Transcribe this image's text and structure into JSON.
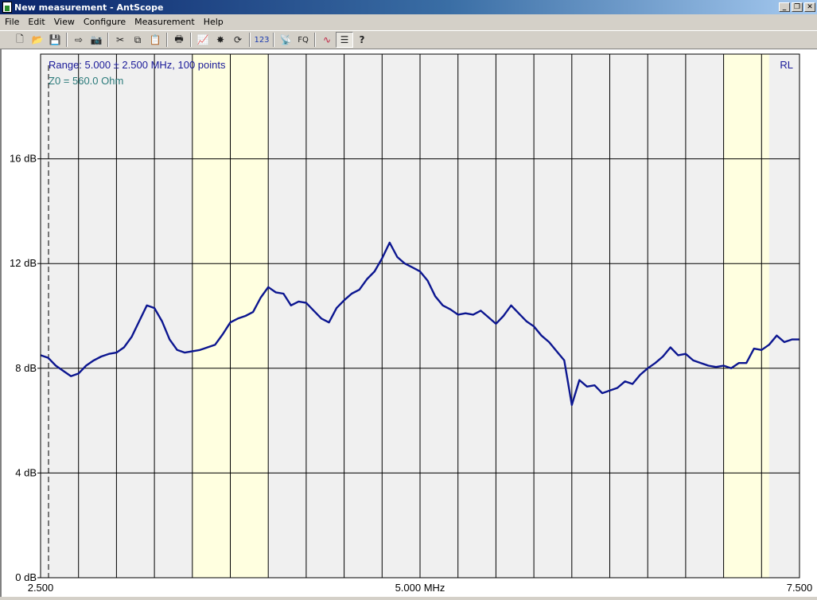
{
  "window": {
    "title": "New measurement - AntScope",
    "buttons": {
      "minimize": "_",
      "restore": "❐",
      "close": "✕"
    }
  },
  "menu": [
    "File",
    "Edit",
    "View",
    "Configure",
    "Measurement",
    "Help"
  ],
  "toolbar": {
    "buttons": [
      {
        "name": "new-icon",
        "glyph": "🗋"
      },
      {
        "name": "open-icon",
        "glyph": "📂"
      },
      {
        "name": "save-icon",
        "glyph": "💾"
      },
      {
        "name": "export-icon",
        "glyph": "⇨"
      },
      {
        "name": "camera-icon",
        "glyph": "📷"
      },
      {
        "name": "cut-icon",
        "glyph": "✂"
      },
      {
        "name": "copy-icon",
        "glyph": "⧉"
      },
      {
        "name": "paste-icon",
        "glyph": "📋"
      },
      {
        "name": "print-icon",
        "glyph": "🖶"
      },
      {
        "name": "chart-icon",
        "glyph": "📈"
      },
      {
        "name": "burst-icon",
        "glyph": "✸"
      },
      {
        "name": "refresh-icon",
        "glyph": "⟳"
      },
      {
        "name": "numbers-icon",
        "glyph": "123"
      },
      {
        "name": "antenna-icon",
        "glyph": "📡"
      },
      {
        "name": "fq-icon",
        "glyph": "FQ"
      },
      {
        "name": "wave-icon",
        "glyph": "∿"
      },
      {
        "name": "legend-icon",
        "glyph": "☰"
      },
      {
        "name": "help-icon",
        "glyph": "?"
      }
    ]
  },
  "colors": {
    "curve": "#0c1690",
    "band": "#ffffe0",
    "plot_bg": "#f0f0f0",
    "range_text": "#1a1a99",
    "z0_text": "#2a7a7a"
  },
  "chart_data": {
    "type": "line",
    "title": "",
    "info_lines": [
      "Range: 5.000 ± 2.500 MHz, 100 points",
      "Z0 = 560.0 Ohm"
    ],
    "trace_label": "RL",
    "ylim": [
      0,
      20
    ],
    "yticks": [
      0,
      4,
      8,
      12,
      16
    ],
    "ytick_labels": [
      "0 dB",
      "4 dB",
      "8 dB",
      "12 dB",
      "16 dB"
    ],
    "xlim": [
      2.5,
      7.5
    ],
    "xtick_labels": [
      "2.500",
      "5.000 MHz",
      "7.500"
    ],
    "bands_mhz": [
      [
        3.5,
        4.0
      ],
      [
        7.0,
        7.3
      ]
    ],
    "series": [
      {
        "x": [
          2.5,
          2.55,
          2.6,
          2.65,
          2.7,
          2.75,
          2.8,
          2.85,
          2.9,
          2.95,
          3.0,
          3.05,
          3.1,
          3.15,
          3.2,
          3.25,
          3.3,
          3.35,
          3.4,
          3.45,
          3.5,
          3.55,
          3.6,
          3.65,
          3.7,
          3.75,
          3.8,
          3.85,
          3.9,
          3.95,
          4.0,
          4.05,
          4.1,
          4.15,
          4.2,
          4.25,
          4.3,
          4.35,
          4.4,
          4.45,
          4.5,
          4.55,
          4.6,
          4.65,
          4.7,
          4.75,
          4.8,
          4.85,
          4.9,
          4.95,
          5.0,
          5.05,
          5.1,
          5.15,
          5.2,
          5.25,
          5.3,
          5.35,
          5.4,
          5.45,
          5.5,
          5.55,
          5.6,
          5.65,
          5.7,
          5.75,
          5.8,
          5.85,
          5.9,
          5.95,
          6.0,
          6.05,
          6.1,
          6.15,
          6.2,
          6.25,
          6.3,
          6.35,
          6.4,
          6.45,
          6.5,
          6.55,
          6.6,
          6.65,
          6.7,
          6.75,
          6.8,
          6.85,
          6.9,
          6.95,
          7.0,
          7.05,
          7.1,
          7.15,
          7.2,
          7.25,
          7.3,
          7.35,
          7.4,
          7.45,
          7.5
        ],
        "y": [
          8.5,
          8.4,
          8.1,
          7.9,
          7.7,
          7.8,
          8.1,
          8.3,
          8.45,
          8.55,
          8.6,
          8.8,
          9.2,
          9.8,
          10.4,
          10.3,
          9.8,
          9.1,
          8.7,
          8.6,
          8.65,
          8.7,
          8.8,
          8.9,
          9.3,
          9.75,
          9.9,
          10.0,
          10.15,
          10.7,
          11.1,
          10.9,
          10.85,
          10.4,
          10.55,
          10.5,
          10.2,
          9.9,
          9.75,
          10.3,
          10.6,
          10.85,
          11.0,
          11.4,
          11.7,
          12.2,
          12.8,
          12.25,
          12.0,
          11.85,
          11.7,
          11.35,
          10.75,
          10.4,
          10.25,
          10.05,
          10.1,
          10.05,
          10.2,
          9.95,
          9.7,
          10.0,
          10.4,
          10.1,
          9.8,
          9.6,
          9.25,
          9.0,
          8.65,
          8.3,
          6.6,
          7.55,
          7.3,
          7.35,
          7.05,
          7.15,
          7.25,
          7.5,
          7.4,
          7.75,
          8.0,
          8.2,
          8.45,
          8.8,
          8.5,
          8.55,
          8.3,
          8.2,
          8.1,
          8.05,
          8.1,
          8.0,
          8.2,
          8.2,
          8.75,
          8.7,
          8.9,
          9.25,
          9.0,
          9.1,
          9.1
        ]
      }
    ]
  }
}
